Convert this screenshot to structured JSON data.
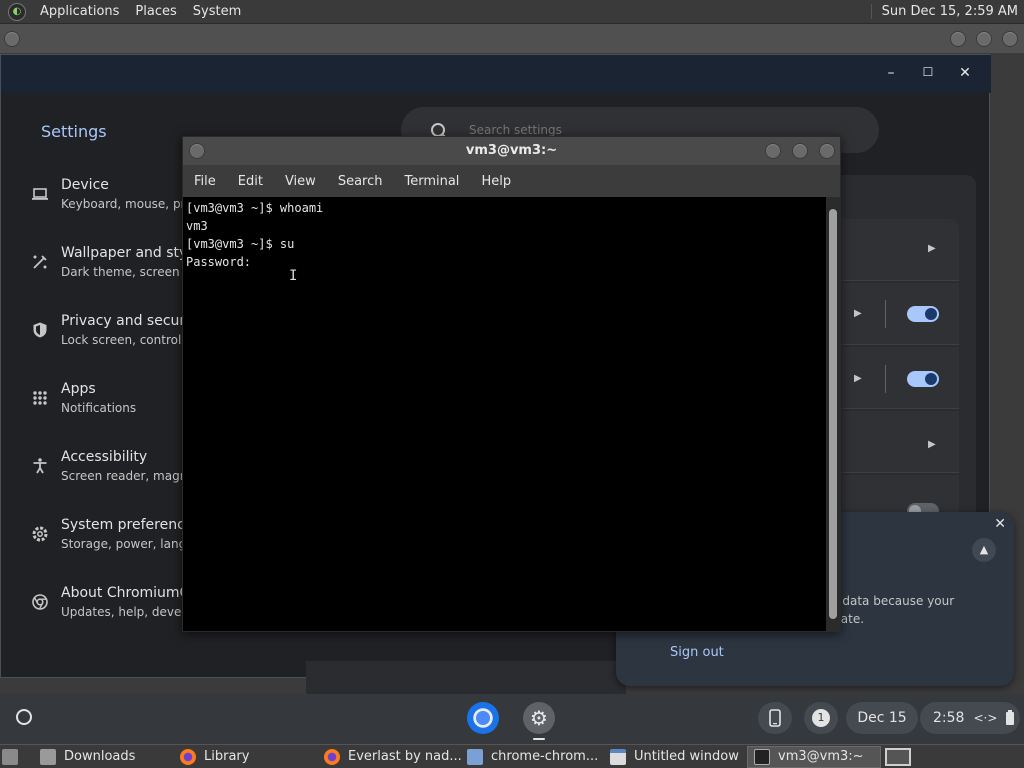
{
  "top_panel": {
    "menus": [
      "Applications",
      "Places",
      "System"
    ],
    "clock": "Sun Dec 15,  2:59 AM"
  },
  "settings": {
    "title": "Settings",
    "search_placeholder": "Search settings",
    "nav": [
      {
        "title": "Device",
        "sub": "Keyboard, mouse, pr",
        "icon": "laptop-icon"
      },
      {
        "title": "Wallpaper and style",
        "sub": "Dark theme, screen s",
        "icon": "paint-brush-icon"
      },
      {
        "title": "Privacy and security",
        "sub": "Lock screen, controls",
        "icon": "shield-icon"
      },
      {
        "title": "Apps",
        "sub": "Notifications",
        "icon": "apps-grid-icon"
      },
      {
        "title": "Accessibility",
        "sub": "Screen reader, magn",
        "icon": "accessibility-icon"
      },
      {
        "title": "System preferences",
        "sub": "Storage, power, langu",
        "icon": "gear-icon"
      },
      {
        "title": "About ChromiumOS",
        "sub": "Updates, help, develo",
        "icon": "chromium-icon"
      }
    ],
    "window_controls": {
      "minimize": "–",
      "maximize": "☐",
      "close": "✕"
    }
  },
  "notification": {
    "message_line1": "ur data because your",
    "message_line2": "l date.",
    "signout_label": "Sign out",
    "close_glyph": "✕",
    "expand_glyph": "▲"
  },
  "shelf": {
    "notification_count": "1",
    "date": "Dec 15",
    "time": "2:58"
  },
  "terminal": {
    "title": "vm3@vm3:~",
    "menus": [
      "File",
      "Edit",
      "View",
      "Search",
      "Terminal",
      "Help"
    ],
    "lines": [
      "[vm3@vm3 ~]$ whoami",
      "vm3",
      "[vm3@vm3 ~]$ su",
      "Password: "
    ]
  },
  "taskbar": {
    "tasks": [
      {
        "label": "Downloads",
        "icon": "folder-icon"
      },
      {
        "label": "Library",
        "icon": "firefox-icon"
      },
      {
        "label": "Everlast by nad...",
        "icon": "firefox-icon"
      },
      {
        "label": "chrome-chrom...",
        "icon": "app-window-icon"
      },
      {
        "label": "Untitled window",
        "icon": "window-icon"
      },
      {
        "label": "vm3@vm3:~",
        "icon": "terminal-icon"
      }
    ]
  }
}
